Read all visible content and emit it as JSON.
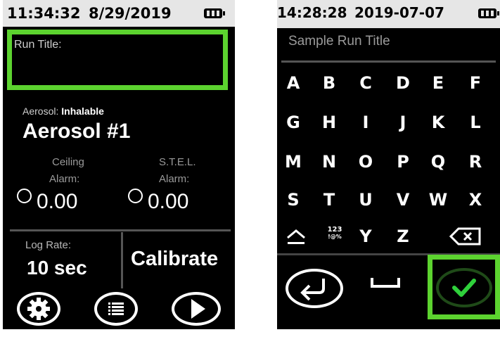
{
  "left_screen": {
    "status": {
      "time": "11:34:32",
      "date": "8/29/2019"
    },
    "run_title_label": "Run Title:",
    "aerosol": {
      "label": "Aerosol:",
      "type": "Inhalable",
      "name": "Aerosol #1"
    },
    "ceiling_alarm": {
      "title": "Ceiling",
      "label": "Alarm:",
      "value": "0.00"
    },
    "stel_alarm": {
      "title": "S.T.E.L.",
      "label": "Alarm:",
      "value": "0.00"
    },
    "log_rate": {
      "label": "Log Rate:",
      "value": "10 sec"
    },
    "calibrate_label": "Calibrate",
    "buttons": {
      "settings": "gear-icon",
      "menu": "list-icon",
      "run": "play-icon"
    }
  },
  "right_screen": {
    "status": {
      "time": "14:28:28",
      "date": "2019-07-07"
    },
    "title_field": "Sample Run Title",
    "keyboard": {
      "rows": [
        [
          "A",
          "B",
          "C",
          "D",
          "E",
          "F"
        ],
        [
          "G",
          "H",
          "I",
          "J",
          "K",
          "L"
        ],
        [
          "M",
          "N",
          "O",
          "P",
          "Q",
          "R"
        ],
        [
          "S",
          "T",
          "U",
          "V",
          "W",
          "X"
        ]
      ],
      "last_row": {
        "shift": "shift-icon",
        "symbols_top": "123",
        "symbols_bottom": "!@%",
        "y": "Y",
        "z": "Z",
        "backspace": "backspace-icon"
      }
    },
    "buttons": {
      "enter": "enter-icon",
      "space": "space-icon",
      "confirm": "check-icon"
    },
    "accent_color": "#5cd32f",
    "check_color": "#2fd13b"
  }
}
